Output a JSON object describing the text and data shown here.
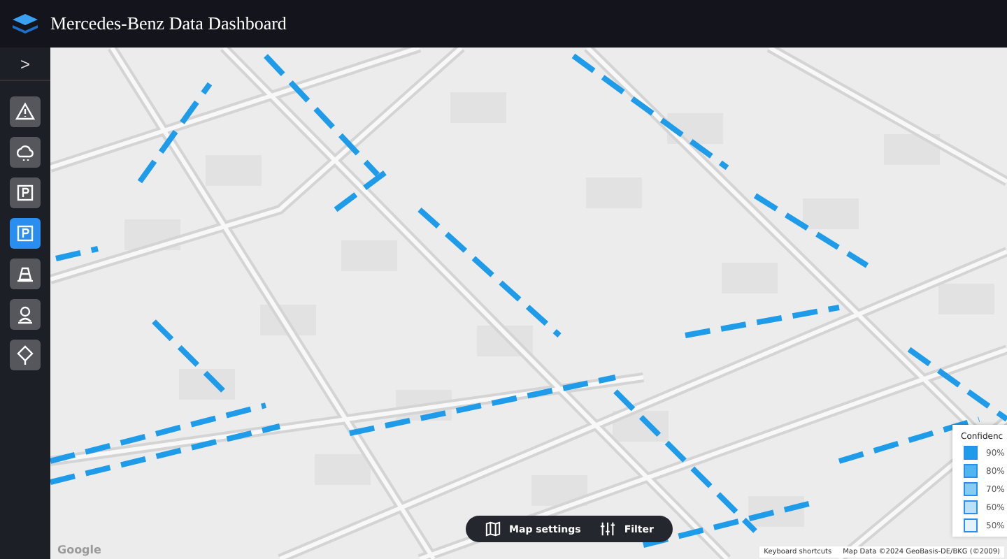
{
  "header": {
    "title": "Mercedes-Benz Data Dashboard"
  },
  "sidebar": {
    "toggle": ">",
    "items": [
      {
        "kind": "warning",
        "selected": false
      },
      {
        "kind": "weather",
        "selected": false
      },
      {
        "kind": "parking",
        "selected": false
      },
      {
        "kind": "parking",
        "selected": true
      },
      {
        "kind": "cone",
        "selected": false
      },
      {
        "kind": "person",
        "selected": false
      },
      {
        "kind": "pin",
        "selected": false
      }
    ]
  },
  "map": {
    "attribution_logo": "Google",
    "shortcuts": "Keyboard shortcuts",
    "map_data": "Map Data ©2024 GeoBasis-DE/BKG (©2009)"
  },
  "toolbar": [
    {
      "kind": "map",
      "label": "Map settings"
    },
    {
      "kind": "filter",
      "label": "Filter"
    }
  ],
  "legend": {
    "title": "Confidenc",
    "items": [
      {
        "label": "90%",
        "color": "#1e9be9"
      },
      {
        "label": "80%",
        "color": "#4fb6f0"
      },
      {
        "label": "70%",
        "color": "#86cdf4"
      },
      {
        "label": "60%",
        "color": "#b9e1f8"
      },
      {
        "label": "50%",
        "color": "#e4f2fb"
      }
    ]
  }
}
